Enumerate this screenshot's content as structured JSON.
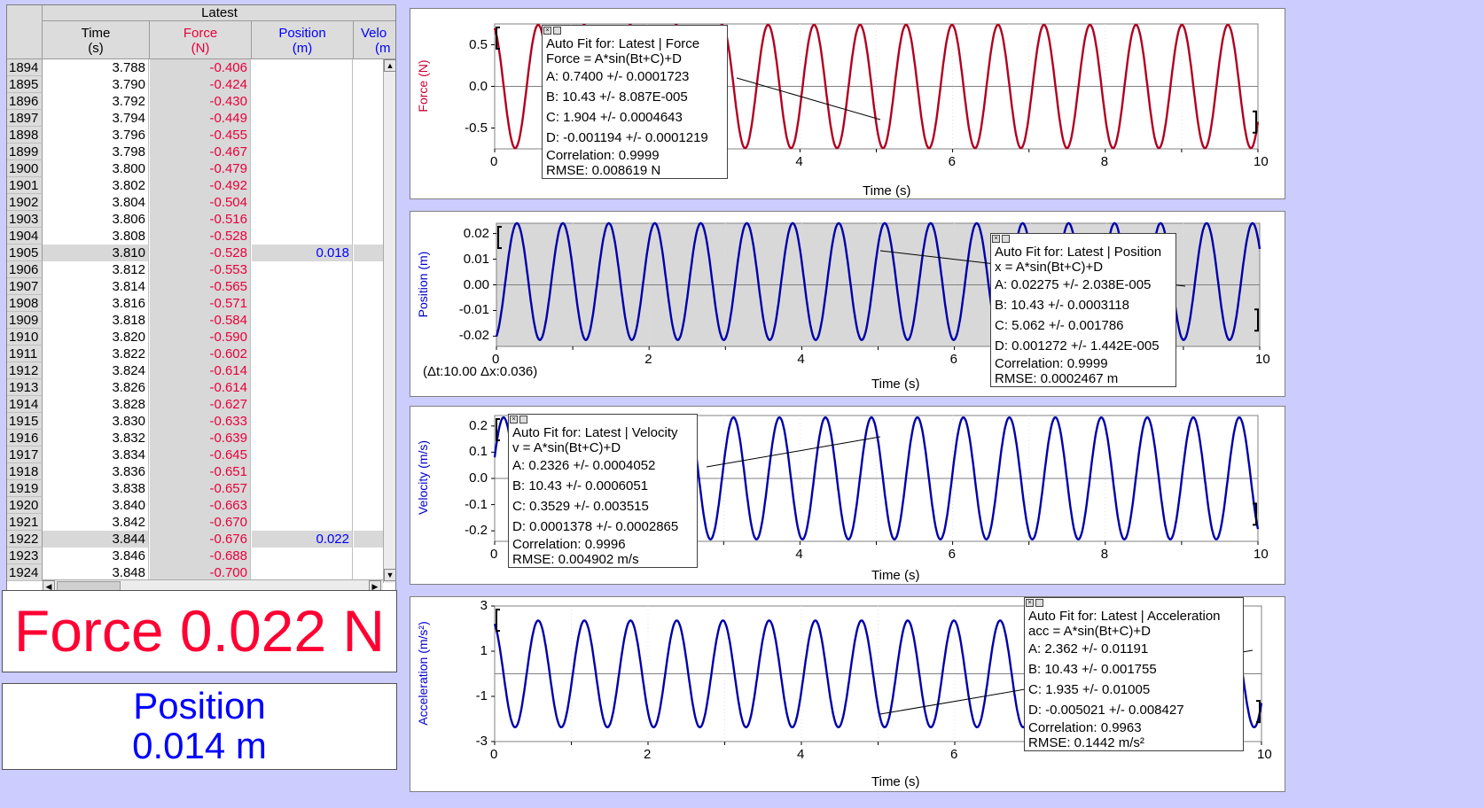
{
  "table": {
    "group_header": "Latest",
    "columns": [
      {
        "name": "Time",
        "unit": "(s)",
        "color": "#000000"
      },
      {
        "name": "Force",
        "unit": "(N)",
        "color": "#e8003a"
      },
      {
        "name": "Position",
        "unit": "(m)",
        "color": "#0000ff"
      },
      {
        "name": "Velo",
        "unit": "(m",
        "color": "#0000ff"
      }
    ],
    "rows": [
      {
        "i": "1894",
        "t": "3.788",
        "f": "-0.406",
        "p": ""
      },
      {
        "i": "1895",
        "t": "3.790",
        "f": "-0.424",
        "p": ""
      },
      {
        "i": "1896",
        "t": "3.792",
        "f": "-0.430",
        "p": ""
      },
      {
        "i": "1897",
        "t": "3.794",
        "f": "-0.449",
        "p": ""
      },
      {
        "i": "1898",
        "t": "3.796",
        "f": "-0.455",
        "p": ""
      },
      {
        "i": "1899",
        "t": "3.798",
        "f": "-0.467",
        "p": ""
      },
      {
        "i": "1900",
        "t": "3.800",
        "f": "-0.479",
        "p": ""
      },
      {
        "i": "1901",
        "t": "3.802",
        "f": "-0.492",
        "p": ""
      },
      {
        "i": "1902",
        "t": "3.804",
        "f": "-0.504",
        "p": ""
      },
      {
        "i": "1903",
        "t": "3.806",
        "f": "-0.516",
        "p": ""
      },
      {
        "i": "1904",
        "t": "3.808",
        "f": "-0.528",
        "p": ""
      },
      {
        "i": "1905",
        "t": "3.810",
        "f": "-0.528",
        "p": "0.018",
        "sel": true
      },
      {
        "i": "1906",
        "t": "3.812",
        "f": "-0.553",
        "p": ""
      },
      {
        "i": "1907",
        "t": "3.814",
        "f": "-0.565",
        "p": ""
      },
      {
        "i": "1908",
        "t": "3.816",
        "f": "-0.571",
        "p": ""
      },
      {
        "i": "1909",
        "t": "3.818",
        "f": "-0.584",
        "p": ""
      },
      {
        "i": "1910",
        "t": "3.820",
        "f": "-0.590",
        "p": ""
      },
      {
        "i": "1911",
        "t": "3.822",
        "f": "-0.602",
        "p": ""
      },
      {
        "i": "1912",
        "t": "3.824",
        "f": "-0.614",
        "p": ""
      },
      {
        "i": "1913",
        "t": "3.826",
        "f": "-0.614",
        "p": ""
      },
      {
        "i": "1914",
        "t": "3.828",
        "f": "-0.627",
        "p": ""
      },
      {
        "i": "1915",
        "t": "3.830",
        "f": "-0.633",
        "p": ""
      },
      {
        "i": "1916",
        "t": "3.832",
        "f": "-0.639",
        "p": ""
      },
      {
        "i": "1917",
        "t": "3.834",
        "f": "-0.645",
        "p": ""
      },
      {
        "i": "1918",
        "t": "3.836",
        "f": "-0.651",
        "p": ""
      },
      {
        "i": "1919",
        "t": "3.838",
        "f": "-0.657",
        "p": ""
      },
      {
        "i": "1920",
        "t": "3.840",
        "f": "-0.663",
        "p": ""
      },
      {
        "i": "1921",
        "t": "3.842",
        "f": "-0.670",
        "p": ""
      },
      {
        "i": "1922",
        "t": "3.844",
        "f": "-0.676",
        "p": "0.022",
        "sel": true
      },
      {
        "i": "1923",
        "t": "3.846",
        "f": "-0.688",
        "p": ""
      },
      {
        "i": "1924",
        "t": "3.848",
        "f": "-0.700",
        "p": ""
      }
    ]
  },
  "meters": {
    "force": {
      "text": "Force 0.022 N",
      "color": "#ff0033"
    },
    "position": {
      "line1": "Position",
      "line2": "0.014 m",
      "color": "#0000ff"
    }
  },
  "graphs": [
    {
      "id": "force",
      "ylabel": "Force (N)",
      "ycolor": "#cc0033",
      "line_color": "#b00020",
      "xlabel": "Time (s)",
      "yticks": [
        "0.5",
        "0.0",
        "-0.5"
      ],
      "xticks": [
        "0",
        "4",
        "6",
        "8",
        "10"
      ],
      "delta": "",
      "fit": {
        "title": "Auto Fit for: Latest | Force",
        "eq": "Force = A*sin(Bt+C)+D",
        "A": "A: 0.7400 +/- 0.0001723",
        "B": "B: 10.43 +/- 8.087E-005",
        "C": "C: 1.904 +/- 0.0004643",
        "D": "D: -0.001194 +/- 0.0001219",
        "corr": "Correlation: 0.9999",
        "rmse": "RMSE: 0.008619 N"
      }
    },
    {
      "id": "position",
      "ylabel": "Position (m)",
      "ycolor": "#0000cc",
      "line_color": "#0000aa",
      "xlabel": "Time (s)",
      "yticks": [
        "0.02",
        "0.01",
        "0.00",
        "-0.01",
        "-0.02"
      ],
      "xticks": [
        "0",
        "2",
        "4",
        "6",
        "10"
      ],
      "delta": "(Δt:10.00 Δx:0.036)",
      "fit": {
        "title": "Auto Fit for: Latest | Position",
        "eq": "x = A*sin(Bt+C)+D",
        "A": "A: 0.02275 +/- 2.038E-005",
        "B": "B: 10.43 +/- 0.0003118",
        "C": "C: 5.062 +/- 0.001786",
        "D": "D: 0.001272 +/- 1.442E-005",
        "corr": "Correlation: 0.9999",
        "rmse": "RMSE: 0.0002467 m"
      }
    },
    {
      "id": "velocity",
      "ylabel": "Velocity (m/s)",
      "ycolor": "#0000cc",
      "line_color": "#0000aa",
      "xlabel": "Time (s)",
      "yticks": [
        "0.2",
        "0.1",
        "0.0",
        "-0.1",
        "-0.2"
      ],
      "xticks": [
        "0",
        "4",
        "6",
        "8",
        "10"
      ],
      "delta": "",
      "fit": {
        "title": "Auto Fit for: Latest | Velocity",
        "eq": "v = A*sin(Bt+C)+D",
        "A": "A: 0.2326 +/- 0.0004052",
        "B": "B: 10.43 +/- 0.0006051",
        "C": "C: 0.3529 +/- 0.003515",
        "D": "D: 0.0001378 +/- 0.0002865",
        "corr": "Correlation: 0.9996",
        "rmse": "RMSE: 0.004902 m/s"
      }
    },
    {
      "id": "acceleration",
      "ylabel": "Acceleration (m/s²)",
      "ycolor": "#0000cc",
      "line_color": "#0000aa",
      "xlabel": "Time (s)",
      "yticks": [
        "3",
        "1",
        "-1",
        "-3"
      ],
      "xticks": [
        "0",
        "2",
        "4",
        "6",
        "10"
      ],
      "delta": "",
      "fit": {
        "title": "Auto Fit for: Latest | Acceleration",
        "eq": "acc = A*sin(Bt+C)+D",
        "A": "A: 2.362 +/- 0.01191",
        "B": "B: 10.43 +/- 0.001755",
        "C": "C: 1.935 +/- 0.01005",
        "D": "D: -0.005021 +/- 0.008427",
        "corr": "Correlation: 0.9963",
        "rmse": "RMSE: 0.1442 m/s²"
      }
    }
  ],
  "chart_data": [
    {
      "type": "line",
      "title": "",
      "xlabel": "Time (s)",
      "ylabel": "Force (N)",
      "xlim": [
        0,
        10
      ],
      "ylim": [
        -0.75,
        0.75
      ],
      "series": [
        {
          "fit": "A*sin(Bt+C)+D",
          "A": 0.74,
          "B": 10.43,
          "C": 1.904,
          "D": -0.001194
        }
      ]
    },
    {
      "type": "line",
      "title": "",
      "xlabel": "Time (s)",
      "ylabel": "Position (m)",
      "xlabel2": "",
      "xlim": [
        0,
        10
      ],
      "ylim": [
        -0.024,
        0.024
      ],
      "series": [
        {
          "fit": "A*sin(Bt+C)+D",
          "A": 0.02275,
          "B": 10.43,
          "C": 5.062,
          "D": 0.001272
        }
      ]
    },
    {
      "type": "line",
      "title": "",
      "xlabel": "Time (s)",
      "ylabel": "Velocity (m/s)",
      "xlim": [
        0,
        10
      ],
      "ylim": [
        -0.24,
        0.24
      ],
      "series": [
        {
          "fit": "A*sin(Bt+C)+D",
          "A": 0.2326,
          "B": 10.43,
          "C": 0.3529,
          "D": 0.0001378
        }
      ]
    },
    {
      "type": "line",
      "title": "",
      "xlabel": "Time (s)",
      "ylabel": "Acceleration (m/s²)",
      "xlim": [
        0,
        10
      ],
      "ylim": [
        -3,
        3
      ],
      "series": [
        {
          "fit": "A*sin(Bt+C)+D",
          "A": 2.362,
          "B": 10.43,
          "C": 1.935,
          "D": -0.005021
        }
      ]
    }
  ]
}
